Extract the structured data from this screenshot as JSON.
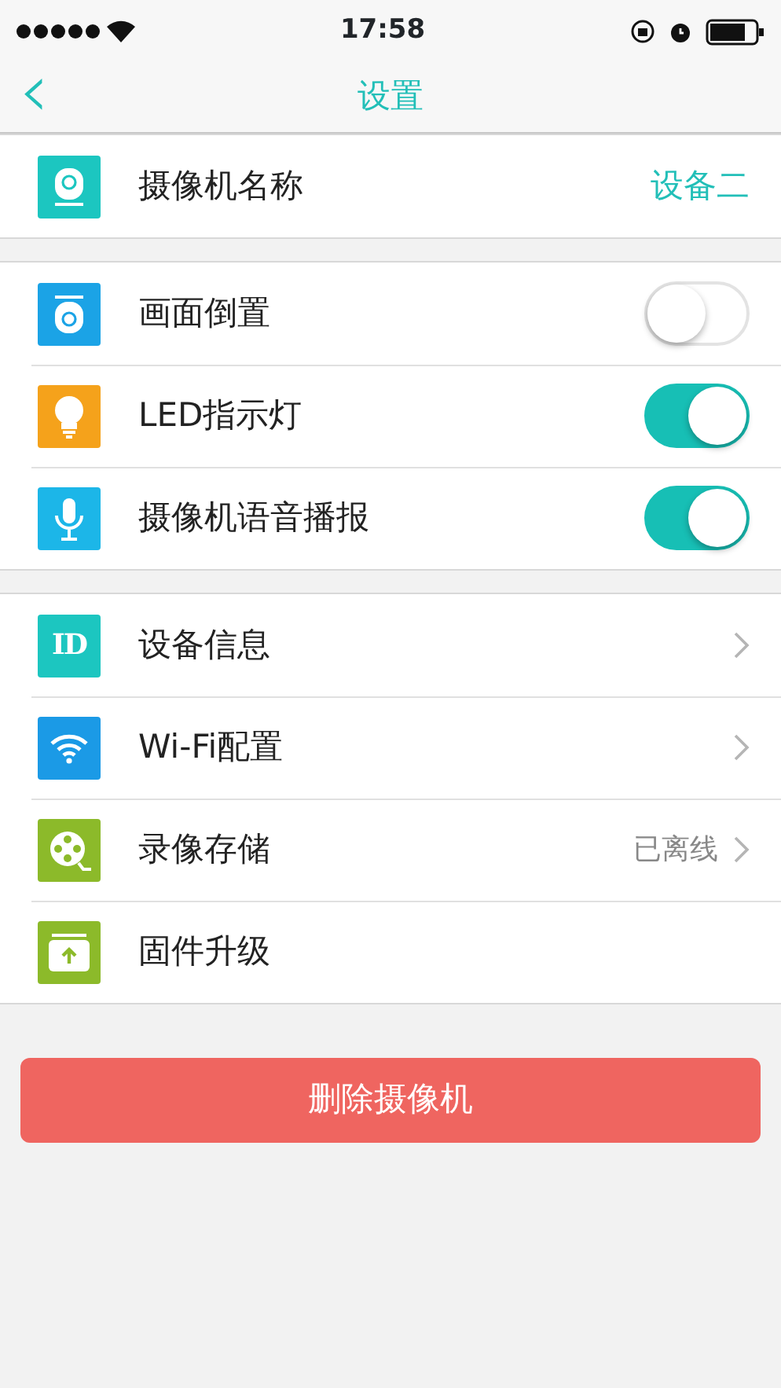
{
  "status_bar": {
    "time": "17:58"
  },
  "nav": {
    "back": "‹",
    "title": "设置"
  },
  "groups": [
    {
      "rows": [
        {
          "kind": "value",
          "color": "#1cc6c0",
          "label": "摄像机名称",
          "value": "设备二"
        }
      ]
    },
    {
      "rows": [
        {
          "kind": "toggle",
          "color": "#1ba3e6",
          "label": "画面倒置",
          "on": false
        },
        {
          "kind": "toggle",
          "color": "#f5a21b",
          "label": "LED指示灯",
          "on": true
        },
        {
          "kind": "toggle",
          "color": "#1cb6e8",
          "label": "摄像机语音播报",
          "on": true
        }
      ]
    },
    {
      "rows": [
        {
          "kind": "link",
          "icon_text": "ID",
          "color": "#1cc6c0",
          "label": "设备信息"
        },
        {
          "kind": "link",
          "color": "#1b9ae6",
          "label": "Wi-Fi配置"
        },
        {
          "kind": "link",
          "color": "#8cba2a",
          "label": "录像存储",
          "value": "已离线"
        },
        {
          "kind": "plain",
          "color": "#8cba2a",
          "label": "固件升级"
        }
      ]
    }
  ],
  "delete_button": "删除摄像机"
}
